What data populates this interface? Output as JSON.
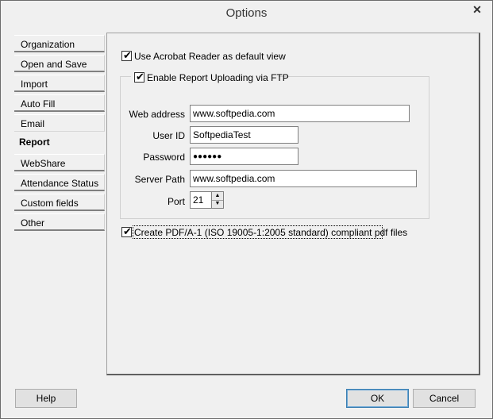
{
  "window": {
    "title": "Options",
    "close_glyph": "✕"
  },
  "sidebar": {
    "items": [
      {
        "label": "Organization"
      },
      {
        "label": "Open and Save"
      },
      {
        "label": "Import"
      },
      {
        "label": "Auto Fill"
      },
      {
        "label": "Email"
      },
      {
        "label": "Report",
        "active": true
      },
      {
        "label": "WebShare"
      },
      {
        "label": "Attendance Status"
      },
      {
        "label": "Custom fields"
      },
      {
        "label": "Other"
      }
    ]
  },
  "report": {
    "use_acrobat_label": "Use Acrobat Reader as default view",
    "use_acrobat_checked": true,
    "ftp_label": "Enable Report Uploading via FTP",
    "ftp_checked": true,
    "web_address_label": "Web address",
    "web_address_value": "www.softpedia.com",
    "user_id_label": "User ID",
    "user_id_value": "SoftpediaTest",
    "password_label": "Password",
    "password_value": "●●●●●●",
    "server_path_label": "Server Path",
    "server_path_value": "www.softpedia.com",
    "port_label": "Port",
    "port_value": "21",
    "pdfa_label": "Create PDF/A-1 (ISO 19005-1:2005 standard) compliant pdf files",
    "pdfa_checked": true,
    "check_glyph": "✔"
  },
  "footer": {
    "help_label": "Help",
    "ok_label": "OK",
    "cancel_label": "Cancel"
  }
}
